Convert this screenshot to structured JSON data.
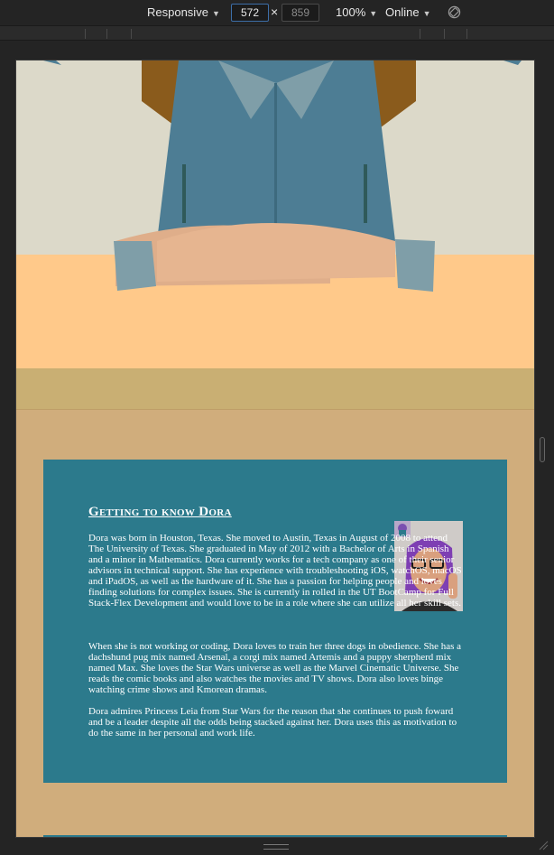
{
  "toolbar": {
    "device": "Responsive",
    "width": "572",
    "height": "859",
    "zoom": "100%",
    "throttling": "Online",
    "caret": "▼",
    "times": "×",
    "icons": {
      "rotate": "rotate-icon"
    }
  },
  "about": {
    "heading": "Getting to know Dora",
    "paragraphs": [
      "Dora was born in Houston, Texas. She moved to Austin, Texas in August of 2008 to attend The University of Texas. She graduated in May of 2012 with a Bachelor of Arts in Spanish and a minor in Mathematics. Dora currently works for a tech company as one of their senior advisors in technical support. She has experience with troubleshooting iOS, watchOS, macOS and iPadOS, as well as the hardware of it. She has a passion for helping people and loves finding solutions for complex issues. She is currently in rolled in the UT BootCamp for Full Stack-Flex Development and would love to be in a role where she can utilize all her skill sets.",
      "When she is not working or coding, Dora loves to train her three dogs in obedience. She has a dachshund pug mix named Arsenal, a corgi mix named Artemis and a puppy sherpherd mix named Max. She loves the Star Wars universe as well as the Marvel Cinematic Universe. She reads the comic books and also watches the movies and TV shows. Dora also loves binge watching crime shows and Kmorean dramas.",
      "Dora admires Princess Leia from Star Wars for the reason that she continues to push foward and be a leader despite all the odds being stacked against her. Dora uses this as motivation to do the same in her personal and work life."
    ]
  },
  "colors": {
    "page_background": "#d0ad7c",
    "about_panel": "#2c7a8c",
    "hero_wall": "#dcd9c9",
    "hero_desk": "#ffc98a",
    "shirt": "#4d7d94",
    "hair": "#8a5b1c",
    "skin": "#e3b28d"
  }
}
